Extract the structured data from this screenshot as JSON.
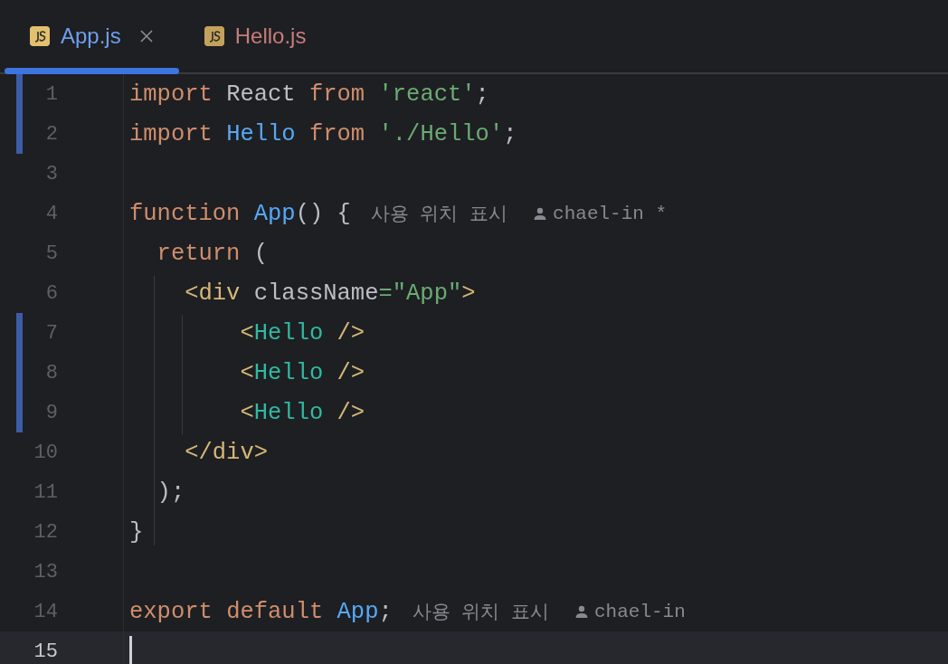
{
  "tabs": [
    {
      "label": "App.js",
      "selected": true,
      "closable": true,
      "color": "#6f9ff0"
    },
    {
      "label": "Hello.js",
      "selected": false,
      "closable": false,
      "color": "#c77d7b"
    }
  ],
  "lines": [
    {
      "number": "1",
      "changed": true,
      "current": false,
      "tokens": [
        {
          "kind": "kw",
          "text": "import"
        },
        {
          "kind": "plain",
          "text": " React "
        },
        {
          "kind": "kw",
          "text": "from"
        },
        {
          "kind": "str",
          "text": " 'react'"
        },
        {
          "kind": "plain",
          "text": ";"
        }
      ]
    },
    {
      "number": "2",
      "changed": true,
      "current": false,
      "tokens": [
        {
          "kind": "kw",
          "text": "import"
        },
        {
          "kind": "fn",
          "text": " Hello"
        },
        {
          "kind": "kw",
          "text": " from"
        },
        {
          "kind": "str",
          "text": " './Hello'"
        },
        {
          "kind": "plain",
          "text": ";"
        }
      ]
    },
    {
      "number": "3",
      "changed": false,
      "current": false
    },
    {
      "number": "4",
      "changed": false,
      "current": false,
      "tokens": [
        {
          "kind": "kw",
          "text": "function"
        },
        {
          "kind": "fn",
          "text": " App"
        },
        {
          "kind": "plain",
          "text": "() {"
        }
      ],
      "usages": "사용 위치 표시",
      "author": "chael-in *"
    },
    {
      "number": "5",
      "changed": false,
      "current": false,
      "tokens": [
        {
          "kind": "kw",
          "text": "  return"
        },
        {
          "kind": "plain",
          "text": " ("
        }
      ]
    },
    {
      "number": "6",
      "changed": false,
      "current": false,
      "tokens": [
        {
          "kind": "tag",
          "text": "    <div"
        },
        {
          "kind": "plain",
          "text": " className"
        },
        {
          "kind": "str",
          "text": "=\"App\""
        },
        {
          "kind": "tag",
          "text": ">"
        }
      ]
    },
    {
      "number": "7",
      "changed": true,
      "current": false,
      "tokens": [
        {
          "kind": "tag",
          "text": "        <"
        },
        {
          "kind": "comp",
          "text": "Hello"
        },
        {
          "kind": "tag",
          "text": " />"
        }
      ]
    },
    {
      "number": "8",
      "changed": true,
      "current": false,
      "tokens": [
        {
          "kind": "tag",
          "text": "        <"
        },
        {
          "kind": "comp",
          "text": "Hello"
        },
        {
          "kind": "tag",
          "text": " />"
        }
      ]
    },
    {
      "number": "9",
      "changed": true,
      "current": false,
      "tokens": [
        {
          "kind": "tag",
          "text": "        <"
        },
        {
          "kind": "comp",
          "text": "Hello"
        },
        {
          "kind": "tag",
          "text": " />"
        }
      ]
    },
    {
      "number": "10",
      "changed": false,
      "current": false,
      "tokens": [
        {
          "kind": "tag",
          "text": "    </div>"
        }
      ]
    },
    {
      "number": "11",
      "changed": false,
      "current": false,
      "tokens": [
        {
          "kind": "plain",
          "text": "  );"
        }
      ]
    },
    {
      "number": "12",
      "changed": false,
      "current": false,
      "tokens": [
        {
          "kind": "plain",
          "text": "}"
        }
      ]
    },
    {
      "number": "13",
      "changed": false,
      "current": false
    },
    {
      "number": "14",
      "changed": false,
      "current": false,
      "tokens": [
        {
          "kind": "kw",
          "text": "export"
        },
        {
          "kind": "kw",
          "text": " default"
        },
        {
          "kind": "fn",
          "text": " App"
        },
        {
          "kind": "plain",
          "text": ";"
        }
      ],
      "usages": "사용 위치 표시",
      "author": "chael-in"
    },
    {
      "number": "15",
      "changed": false,
      "current": true
    }
  ]
}
